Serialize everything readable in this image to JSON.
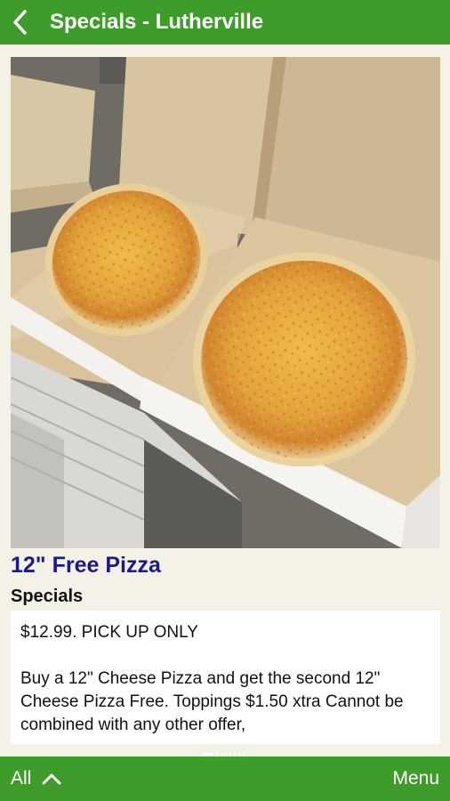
{
  "header": {
    "title": "Specials - Lutherville",
    "back_icon": "chevron-left-icon"
  },
  "item": {
    "title": "12\" Free Pizza",
    "section_label": "Specials",
    "price_line": "$12.99. PICK UP ONLY",
    "description": "Buy a 12\" Cheese Pizza and get the second 12\" Cheese Pizza Free. Toppings $1.50 xtra Cannot be combined with any other offer,"
  },
  "footer": {
    "all_label": "All",
    "all_icon": "chevron-up-icon",
    "menu_label": "Menu"
  },
  "colors": {
    "brand_green": "#3d9c2a",
    "title_blue": "#1a1a8a",
    "background": "#f4f1e6"
  }
}
